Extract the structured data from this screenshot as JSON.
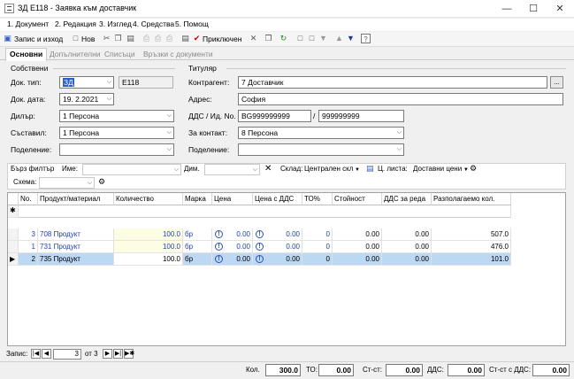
{
  "window": {
    "title": "ЗД Е118 - Заявка към доставчик"
  },
  "menu": [
    "1. Документ",
    "2. Редакция",
    "3. Изглед",
    "4. Средства",
    "5. Помощ"
  ],
  "toolbar": {
    "save_exit": "Запис и изход",
    "new": "Нов",
    "posted": "Приключен"
  },
  "tabs": [
    "Основни",
    "Допълнителни",
    "Списъци",
    "Връзки с документи"
  ],
  "own": {
    "group": "Собствени",
    "doc_type_label": "Док. тип:",
    "doc_type": "ЗД",
    "doc_code": "Е118",
    "doc_date_label": "Док. дата:",
    "doc_date": "19.  2.2021",
    "dealer_label": "Дилър:",
    "dealer": "1 Персона",
    "author_label": "Съставил:",
    "author": "1 Персона",
    "division_label": "Поделение:",
    "division": ""
  },
  "holder": {
    "group": "Титуляр",
    "contractor_label": "Контрагент:",
    "contractor": "7 Доставчик",
    "address_label": "Адрес:",
    "address": "София",
    "vat_label": "ДДС / Ид. No.",
    "vat": "BG999999999",
    "slash": "/",
    "id_no": "999999999",
    "contact_label": "За контакт:",
    "contact": "8 Персона",
    "division_label": "Поделение:",
    "division": ""
  },
  "filter": {
    "quick_filter": "Бърз филтър",
    "name_label": "Име:",
    "name": "",
    "dim_label": "Дим.",
    "dim": "",
    "warehouse_label": "Склад:",
    "warehouse": "Централен скл",
    "pricelist_label": "Ц. листа:",
    "pricelist": "Доставни цени",
    "scheme_label": "Схема:",
    "scheme": ""
  },
  "grid": {
    "headers": [
      "No.",
      "Продукт/материал",
      "Количество",
      "Марка",
      "Цена",
      "Цена с ДДС",
      "ТО%",
      "Стойност",
      "ДДС за реда",
      "Разполагаемо кол."
    ],
    "new_row_marker": "✱",
    "rows": [
      {
        "no": "3",
        "product": "708 Продукт",
        "qty": "100.0",
        "unit": "бр",
        "price": "0.00",
        "price_vat": "0.00",
        "to": "0",
        "value": "0.00",
        "vat_row": "0.00",
        "available": "507.0",
        "selected": false
      },
      {
        "no": "1",
        "product": "731 Продукт",
        "qty": "100.0",
        "unit": "бр",
        "price": "0.00",
        "price_vat": "0.00",
        "to": "0",
        "value": "0.00",
        "vat_row": "0.00",
        "available": "476.0",
        "selected": false
      },
      {
        "no": "2",
        "product": "735 Продукт",
        "qty": "100.0",
        "unit": "бр",
        "price": "0.00",
        "price_vat": "0.00",
        "to": "0",
        "value": "0.00",
        "vat_row": "0.00",
        "available": "101.0",
        "selected": true
      }
    ]
  },
  "nav": {
    "record_label": "Запис:",
    "current": "3",
    "of": "от 3"
  },
  "totals": {
    "qty_label": "Кол.",
    "qty": "300.0",
    "to_label": "ТО:",
    "to": "0.00",
    "value_label": "Ст-ст:",
    "value": "0.00",
    "vat_label": "ДДС:",
    "vat": "0.00",
    "value_vat_label": "Ст-ст с ДДС:",
    "value_vat": "0.00"
  }
}
